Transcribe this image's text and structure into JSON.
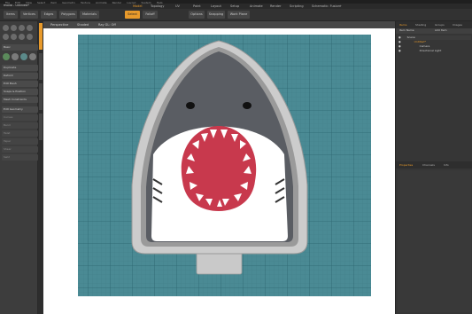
{
  "menubar": {
    "items": [
      "File",
      "Edit",
      "View",
      "Select",
      "Item",
      "Geometry",
      "Texture",
      "Animate",
      "Render",
      "Layout",
      "System",
      "Help"
    ]
  },
  "titlebar": {
    "title": "modo - Untitled*"
  },
  "modes": {
    "buttons": [
      {
        "label": "Items",
        "active": false
      },
      {
        "label": "Vertices",
        "active": false
      },
      {
        "label": "Edges",
        "active": false
      },
      {
        "label": "Polygons",
        "active": false
      },
      {
        "label": "Materials",
        "active": false
      }
    ],
    "action_center": {
      "label": "Select"
    },
    "falloff": {
      "label": "Falloff"
    },
    "options": {
      "label": "Options"
    },
    "snapping": {
      "label": "Snapping"
    },
    "work_plane": {
      "label": "Work Plane"
    },
    "layout_tabs": [
      {
        "label": "Model",
        "active": true
      },
      {
        "label": "Topology",
        "active": false
      },
      {
        "label": "UV",
        "active": false
      },
      {
        "label": "Paint",
        "active": false
      },
      {
        "label": "Layout",
        "active": false
      },
      {
        "label": "Setup",
        "active": false
      },
      {
        "label": "Animate",
        "active": false
      },
      {
        "label": "Render",
        "active": false
      },
      {
        "label": "Scripting",
        "active": false
      },
      {
        "label": "Schematic: Fusion",
        "active": false
      }
    ],
    "add_tab": "+"
  },
  "viewport": {
    "labels": [
      "Perspective",
      "Shaded",
      "Ray GL: Off"
    ]
  },
  "toolbox": {
    "rows": [
      {
        "label": "Basic",
        "dim": false
      },
      {
        "label": "Duplicate",
        "dim": false
      },
      {
        "label": "Deform",
        "dim": false
      },
      {
        "label": "Edit Mesh",
        "dim": false
      },
      {
        "label": "Snaps & Position",
        "dim": false
      },
      {
        "label": "Mesh Constraints",
        "dim": false
      },
      {
        "label": "Edit Geometry",
        "dim": false
      },
      {
        "label": "Curves",
        "dim": true
      },
      {
        "label": "Bend",
        "dim": true
      },
      {
        "label": "Twist",
        "dim": true
      },
      {
        "label": "Taper",
        "dim": true
      },
      {
        "label": "Shear",
        "dim": true
      },
      {
        "label": "Swirl",
        "dim": true
      }
    ]
  },
  "right_panel": {
    "tabs": [
      {
        "label": "Items",
        "active": true
      },
      {
        "label": "Shading",
        "active": false
      },
      {
        "label": "Groups",
        "active": false
      },
      {
        "label": "Images",
        "active": false
      }
    ],
    "header": {
      "name": "Item Name",
      "mask": "Add Item"
    },
    "items": [
      {
        "label": "Scene",
        "indent": 0
      },
      {
        "label": "Untitled*",
        "indent": 1
      },
      {
        "label": "Camera",
        "indent": 2
      },
      {
        "label": "Directional Light",
        "indent": 2
      }
    ],
    "bottom_tabs": [
      {
        "label": "Properties",
        "active": true
      },
      {
        "label": "Channels",
        "active": false
      },
      {
        "label": "Info",
        "active": false
      }
    ]
  },
  "colors": {
    "accent": "#e89a2b",
    "grid_bg": "#4a8a94",
    "grid_line": "#2c6570",
    "shark_gray": "#5a5d63",
    "mouth_red": "#c8394d",
    "frame_gray": "#c9c9c9"
  }
}
